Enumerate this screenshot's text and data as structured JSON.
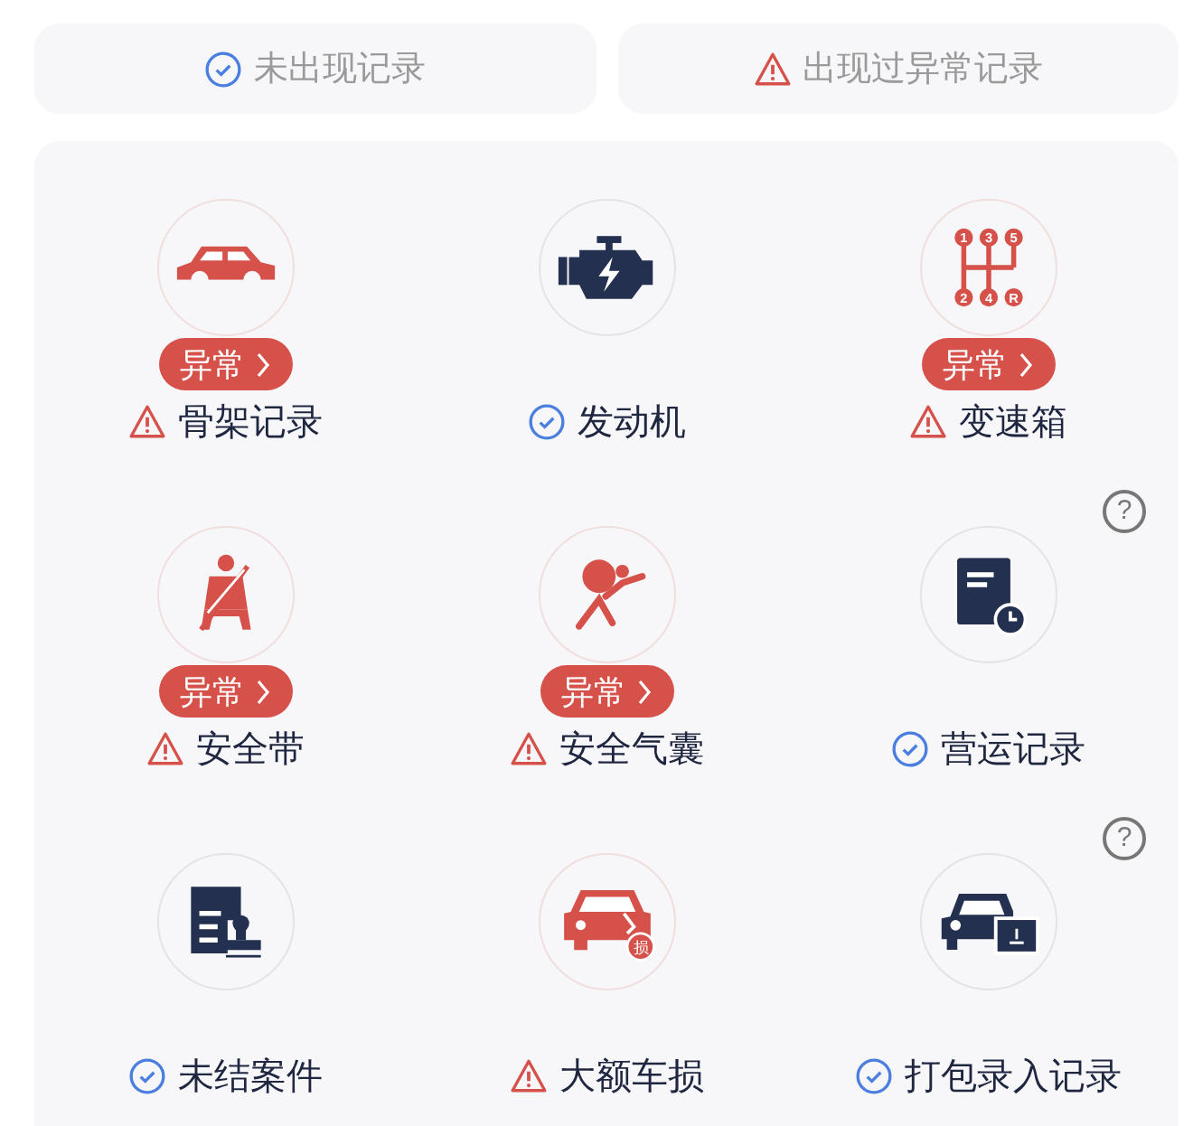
{
  "legend": [
    {
      "kind": "ok",
      "label": "未出现记录"
    },
    {
      "kind": "abnormal",
      "label": "出现过异常记录"
    }
  ],
  "items": [
    {
      "kind": "car",
      "label": "骨架记录",
      "abnormal": true,
      "badge": "异常"
    },
    {
      "kind": "engine",
      "label": "发动机",
      "abnormal": false
    },
    {
      "kind": "gearbox",
      "label": "变速箱",
      "abnormal": true,
      "badge": "异常",
      "icon_marks": [
        "1",
        "3",
        "5",
        "2",
        "4",
        "R"
      ]
    },
    {
      "kind": "seatbelt",
      "label": "安全带",
      "abnormal": true,
      "badge": "异常"
    },
    {
      "kind": "airbag",
      "label": "安全气囊",
      "abnormal": true,
      "badge": "异常"
    },
    {
      "kind": "operation",
      "label": "营运记录",
      "abnormal": false,
      "help": "?"
    },
    {
      "kind": "case",
      "label": "未结案件",
      "abnormal": false
    },
    {
      "kind": "damage",
      "label": "大额车损",
      "abnormal": true,
      "icon_marks": [
        "损"
      ]
    },
    {
      "kind": "package",
      "label": "打包录入记录",
      "abnormal": false,
      "help": "?"
    }
  ]
}
